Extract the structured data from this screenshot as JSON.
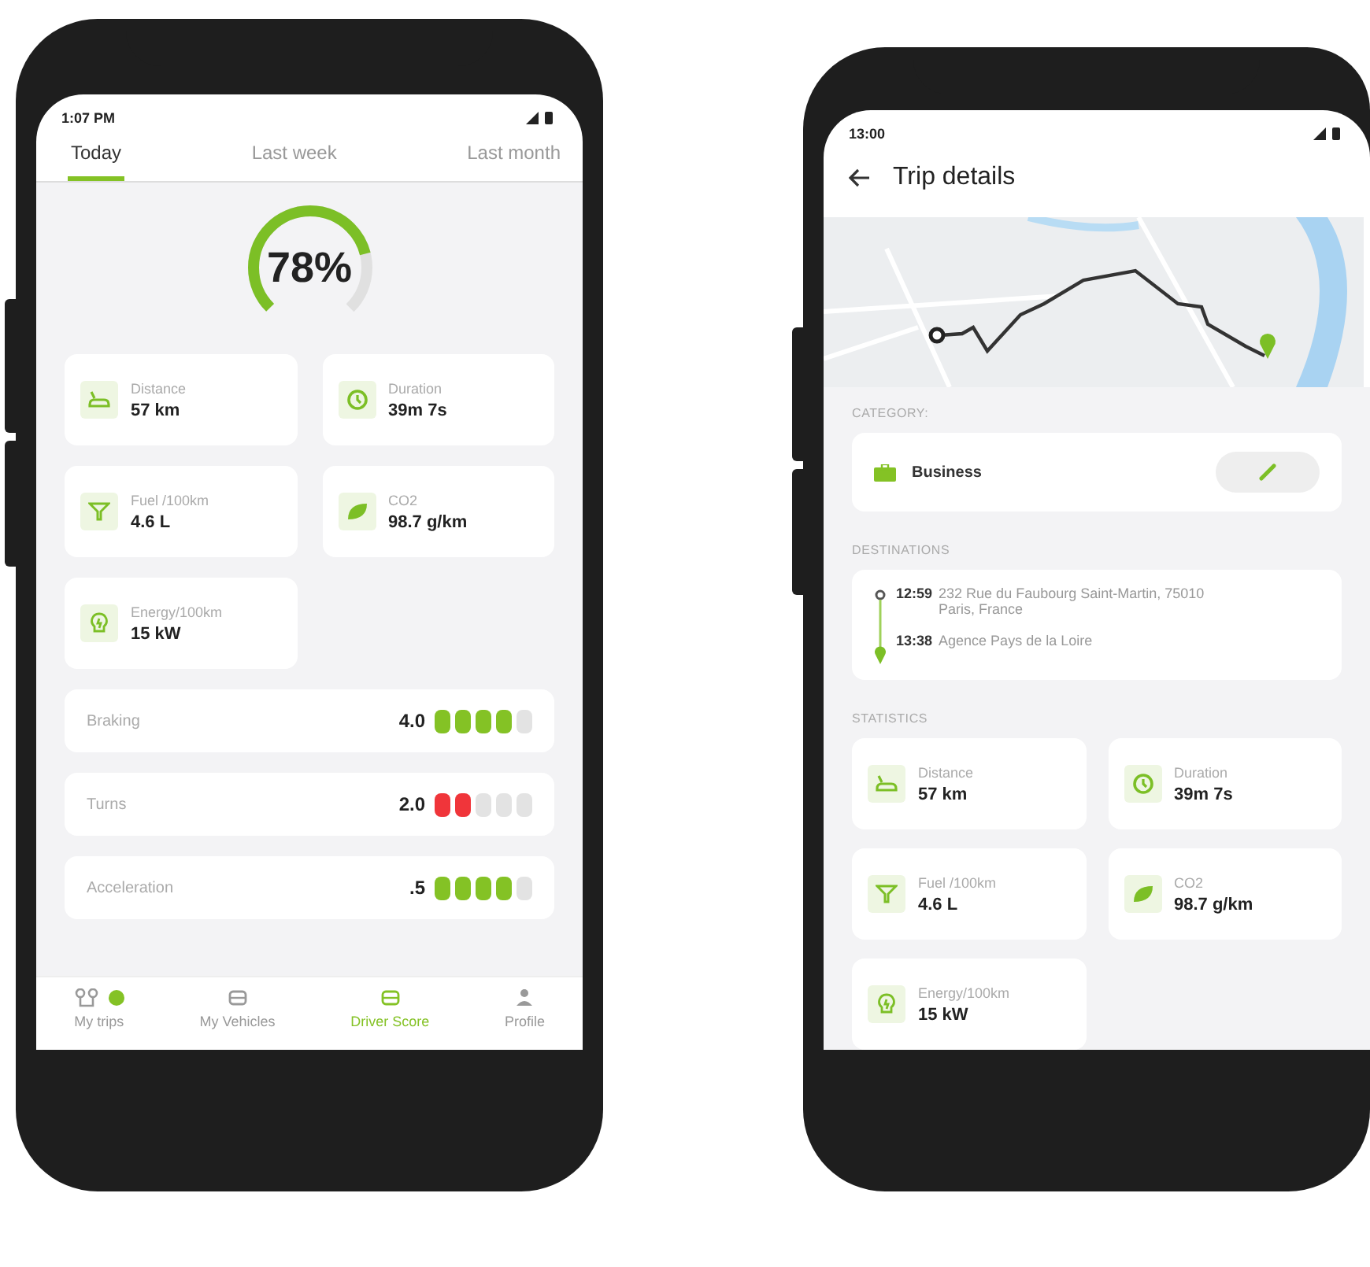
{
  "driver_score_screen": {
    "status_time": "1:07 PM",
    "tabs": [
      {
        "label": "Today",
        "selected": true
      },
      {
        "label": "Last week",
        "selected": false
      },
      {
        "label": "Last month",
        "selected": false
      }
    ],
    "score": {
      "value": "78%",
      "level": 0.78
    },
    "stats": [
      {
        "kind": "distance",
        "label": "Distance",
        "value": "57 km"
      },
      {
        "kind": "duration",
        "label": "Duration",
        "value": "39m 7s"
      },
      {
        "kind": "fuel",
        "label": "Fuel /100km",
        "value": "4.6 L"
      },
      {
        "kind": "co2",
        "label": "CO2",
        "value": "98.7 g/km"
      },
      {
        "kind": "energy",
        "label": "Energy/100km",
        "value": "15 kW"
      }
    ],
    "ratings": [
      {
        "label": "Braking",
        "value": "4.0",
        "stars": 4,
        "color": "#84c225"
      },
      {
        "label": "Turns",
        "value": "2.0",
        "stars": 2,
        "color": "#f0353a"
      },
      {
        "label": "Acceleration",
        "value": ".5",
        "stars": 4,
        "color": "#84c225"
      }
    ],
    "nav": [
      {
        "kind": "trips",
        "label": "My trips",
        "selected": false,
        "badge": true
      },
      {
        "kind": "vehicles",
        "label": "My Vehicles",
        "selected": false,
        "badge": false
      },
      {
        "kind": "score",
        "label": "Driver Score",
        "selected": true,
        "badge": false
      },
      {
        "kind": "profile",
        "label": "Profile",
        "selected": false,
        "badge": false
      }
    ]
  },
  "trip_details_screen": {
    "status_time": "13:00",
    "title": "Trip details",
    "category_heading": "CATEGORY:",
    "category": "Business",
    "destinations_heading": "DESTINATIONS",
    "destinations": [
      {
        "time": "12:59",
        "address": "232 Rue du Faubourg Saint-Martin, 75010 Paris, France"
      },
      {
        "time": "13:38",
        "address": "Agence Pays de la Loire"
      }
    ],
    "statistics_heading": "STATISTICS",
    "stats": [
      {
        "kind": "distance",
        "label": "Distance",
        "value": "57 km"
      },
      {
        "kind": "duration",
        "label": "Duration",
        "value": "39m 7s"
      },
      {
        "kind": "fuel",
        "label": "Fuel /100km",
        "value": "4.6 L"
      },
      {
        "kind": "co2",
        "label": "CO2",
        "value": "98.7 g/km"
      },
      {
        "kind": "energy",
        "label": "Energy/100km",
        "value": "15 kW"
      }
    ]
  }
}
